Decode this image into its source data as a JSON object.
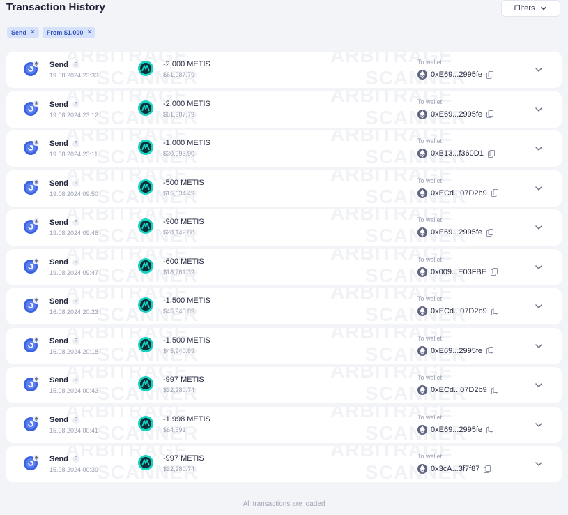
{
  "header": {
    "title": "Transaction History",
    "filters_label": "Filters"
  },
  "chips": [
    {
      "label": "Send"
    },
    {
      "label": "From $1,000"
    }
  ],
  "watermark": {
    "line1": "ARBITRAGE",
    "line2": "SCANNER"
  },
  "row_labels": {
    "to_wallet": "To wallet:",
    "help": "?"
  },
  "transactions": [
    {
      "type": "Send",
      "time": "19.08.2024 23:33",
      "amount": "-2,000 METIS",
      "usd": "$61,987.79",
      "wallet": "0xE69...2995fe"
    },
    {
      "type": "Send",
      "time": "19.08.2024 23:12",
      "amount": "-2,000 METIS",
      "usd": "$61,987.79",
      "wallet": "0xE69...2995fe"
    },
    {
      "type": "Send",
      "time": "19.08.2024 23:11",
      "amount": "-1,000 METIS",
      "usd": "$30,993.90",
      "wallet": "0xB13...f360D1"
    },
    {
      "type": "Send",
      "time": "19.08.2024 09:50",
      "amount": "-500 METIS",
      "usd": "$15,634.49",
      "wallet": "0xECd...07D2b9"
    },
    {
      "type": "Send",
      "time": "19.08.2024 09:48",
      "amount": "-900 METIS",
      "usd": "$28,142.08",
      "wallet": "0xE69...2995fe"
    },
    {
      "type": "Send",
      "time": "19.08.2024 09:47",
      "amount": "-600 METIS",
      "usd": "$18,761.39",
      "wallet": "0x009...E03FBE"
    },
    {
      "type": "Send",
      "time": "16.08.2024 20:23",
      "amount": "-1,500 METIS",
      "usd": "$45,940.89",
      "wallet": "0xECd...07D2b9"
    },
    {
      "type": "Send",
      "time": "16.08.2024 20:18",
      "amount": "-1,500 METIS",
      "usd": "$45,940.89",
      "wallet": "0xE69...2995fe"
    },
    {
      "type": "Send",
      "time": "15.08.2024 00:43",
      "amount": "-997 METIS",
      "usd": "$32,280.74",
      "wallet": "0xECd...07D2b9"
    },
    {
      "type": "Send",
      "time": "15.08.2024 00:41",
      "amount": "-1,998 METIS",
      "usd": "$64,691",
      "wallet": "0xE69...2995fe"
    },
    {
      "type": "Send",
      "time": "15.08.2024 00:39",
      "amount": "-997 METIS",
      "usd": "$32,280.74",
      "wallet": "0x3cA...3f7f87"
    }
  ],
  "footer": {
    "note": "All transactions are loaded"
  },
  "colors": {
    "accent": "#3b63e0",
    "token": "#16d2c3",
    "chip_bg": "#d6e1fb",
    "background": "#f3f4f8"
  },
  "icons": {
    "type": "send-icon",
    "token": "metis-token-icon",
    "wallet_chain": "ethereum-icon",
    "copy": "copy-icon",
    "expand": "chevron-down-icon"
  }
}
